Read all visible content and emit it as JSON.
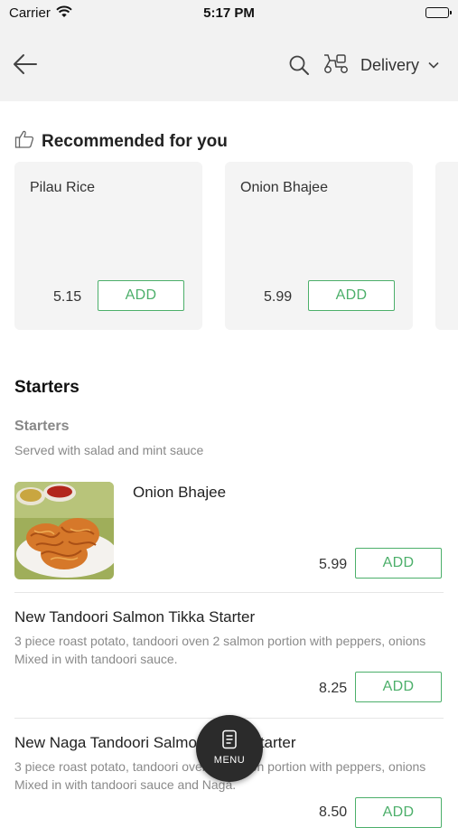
{
  "status_bar": {
    "carrier": "Carrier",
    "time": "5:17 PM"
  },
  "header": {
    "delivery_label": "Delivery"
  },
  "recommended": {
    "title": "Recommended for you",
    "items": [
      {
        "name": "Pilau Rice",
        "price": "5.15",
        "add_label": "ADD"
      },
      {
        "name": "Onion Bhajee",
        "price": "5.99",
        "add_label": "ADD"
      }
    ]
  },
  "section": {
    "title": "Starters",
    "subcategory": "Starters",
    "subcategory_desc": "Served with salad and mint sauce",
    "items": [
      {
        "name": "Onion Bhajee",
        "price": "5.99",
        "add_label": "ADD"
      },
      {
        "name": "New Tandoori Salmon Tikka Starter",
        "desc": "3 piece roast potato, tandoori oven 2 salmon portion with peppers, onions  Mixed in with tandoori sauce.",
        "price": "8.25",
        "add_label": "ADD"
      },
      {
        "name": "New Naga Tandoori Salmon Tikka Starter",
        "desc": "3 piece roast potato, tandoori oven 2 salmon portion with peppers, onions  Mixed in with tandoori sauce and Naga.",
        "price": "8.50",
        "add_label": "ADD"
      }
    ]
  },
  "fab": {
    "label": "MENU"
  },
  "colors": {
    "accent": "#4caf6a",
    "header_bg": "#f2f2f2",
    "card_bg": "#f4f4f4",
    "fab_bg": "#2b2b2b"
  }
}
